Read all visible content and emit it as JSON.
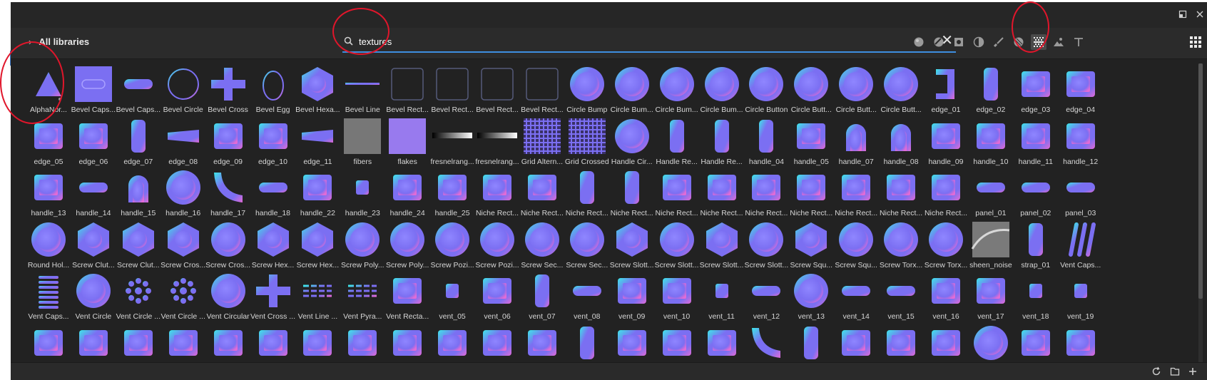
{
  "toolbar": {
    "libraries_label": "All libraries",
    "search_value": "textures",
    "clear_label": "✕"
  },
  "filters": [
    {
      "name": "sphere-filter-icon",
      "glyph": "sphere"
    },
    {
      "name": "material-filter-icon",
      "glyph": "halfsphere"
    },
    {
      "name": "square-filter-icon",
      "glyph": "square"
    },
    {
      "name": "contrast-filter-icon",
      "glyph": "contrast"
    },
    {
      "name": "brush-filter-icon",
      "glyph": "brush"
    },
    {
      "name": "pattern-filter-icon",
      "glyph": "pattern"
    },
    {
      "name": "texture-filter-icon",
      "glyph": "texture",
      "selected": true
    },
    {
      "name": "environment-filter-icon",
      "glyph": "env"
    },
    {
      "name": "text-filter-icon",
      "glyph": "text"
    }
  ],
  "colors": {
    "accent": "#3d8ee0",
    "annotation": "#e0162b",
    "nm_blue": "#7b6ff2",
    "nm_pink": "#e26bd6",
    "nm_cyan": "#3ce8e8",
    "nm_dark": "#4a3fc4"
  },
  "rows": [
    [
      "AlphaNor...",
      "Bevel Caps...",
      "Bevel Caps...",
      "Bevel Circle",
      "Bevel Cross",
      "Bevel Egg",
      "Bevel Hexa...",
      "Bevel Line",
      "Bevel Rect...",
      "Bevel Rect...",
      "Bevel Rect...",
      "Bevel Rect...",
      "Circle Bump",
      "Circle Bum...",
      "Circle Bum...",
      "Circle Bum...",
      "Circle Button",
      "Circle Butt...",
      "Circle Butt...",
      "Circle Butt...",
      "edge_01",
      "edge_02",
      "edge_03",
      "edge_04"
    ],
    [
      "edge_05",
      "edge_06",
      "edge_07",
      "edge_08",
      "edge_09",
      "edge_10",
      "edge_11",
      "fibers",
      "flakes",
      "fresnelrang...",
      "fresnelrang...",
      "Grid Altern...",
      "Grid Crossed",
      "Handle Cir...",
      "Handle Re...",
      "Handle Re...",
      "handle_04",
      "handle_05",
      "handle_07",
      "handle_08",
      "handle_09",
      "handle_10",
      "handle_11",
      "handle_12"
    ],
    [
      "handle_13",
      "handle_14",
      "handle_15",
      "handle_16",
      "handle_17",
      "handle_18",
      "handle_22",
      "handle_23",
      "handle_24",
      "handle_25",
      "Niche Rect...",
      "Niche Rect...",
      "Niche Rect...",
      "Niche Rect...",
      "Niche Rect...",
      "Niche Rect...",
      "Niche Rect...",
      "Niche Rect...",
      "Niche Rect...",
      "Niche Rect...",
      "Niche Rect...",
      "panel_01",
      "panel_02",
      "panel_03"
    ],
    [
      "Round Hol...",
      "Screw Clut...",
      "Screw Clut...",
      "Screw Cros...",
      "Screw Cros...",
      "Screw Hex...",
      "Screw Hex...",
      "Screw Poly...",
      "Screw Poly...",
      "Screw Pozi...",
      "Screw Pozi...",
      "Screw Sec...",
      "Screw Sec...",
      "Screw Slott...",
      "Screw Slott...",
      "Screw Slott...",
      "Screw Slott...",
      "Screw Squ...",
      "Screw Squ...",
      "Screw Torx...",
      "Screw Torx...",
      "sheen_noise",
      "strap_01",
      "Vent Caps..."
    ],
    [
      "Vent Caps...",
      "Vent Circle",
      "Vent Circle ...",
      "Vent Circle ...",
      "Vent Circular",
      "Vent Cross ...",
      "Vent Line ...",
      "Vent Pyra...",
      "Vent Recta...",
      "vent_05",
      "vent_06",
      "vent_07",
      "vent_08",
      "vent_09",
      "vent_10",
      "vent_11",
      "vent_12",
      "vent_13",
      "vent_14",
      "vent_15",
      "vent_16",
      "vent_17",
      "vent_18",
      "vent_19"
    ]
  ],
  "shapes": [
    [
      "triangle",
      "sq",
      "capsule",
      "ring",
      "cross",
      "egg",
      "hexagon",
      "line",
      "outline",
      "outline",
      "outline",
      "outline",
      "disc",
      "disc",
      "disc",
      "disc",
      "disc",
      "disc",
      "disc",
      "disc",
      "bracket",
      "tall",
      "box",
      "box"
    ],
    [
      "box",
      "box",
      "tall",
      "bar",
      "box",
      "box",
      "bar",
      "noise",
      "noiseblue",
      "gradient",
      "gradient",
      "grid",
      "grid",
      "disc",
      "tall",
      "tall",
      "tall",
      "box",
      "arch",
      "arch",
      "box",
      "box",
      "box",
      "box"
    ],
    [
      "box",
      "capsule",
      "arch",
      "disc",
      "curve",
      "capsule",
      "box",
      "small",
      "box",
      "box",
      "box",
      "box",
      "tall",
      "tall",
      "box",
      "box",
      "box",
      "box",
      "box",
      "box",
      "box",
      "capsule",
      "capsule",
      "capsule"
    ],
    [
      "disc",
      "hexagon",
      "hexagon",
      "hexagon",
      "disc",
      "hexagon",
      "hexagon",
      "disc",
      "disc",
      "disc",
      "disc",
      "disc",
      "disc",
      "hexagon",
      "disc",
      "hexagon",
      "disc",
      "hexagon",
      "disc",
      "disc",
      "disc",
      "sheen",
      "tall",
      "slats"
    ],
    [
      "lines",
      "disc",
      "dots",
      "dots",
      "disc",
      "cross",
      "dashes",
      "dashes",
      "box",
      "small",
      "box",
      "tall",
      "capsule",
      "box",
      "box",
      "small",
      "capsule",
      "disc",
      "capsule",
      "capsule",
      "box",
      "box",
      "small",
      "small"
    ],
    [
      "box",
      "box",
      "box",
      "box",
      "box",
      "box",
      "box",
      "box",
      "box",
      "box",
      "box",
      "box",
      "tall",
      "box",
      "box",
      "box",
      "curve",
      "tall",
      "box",
      "box",
      "box",
      "disc",
      "box",
      "box"
    ]
  ]
}
